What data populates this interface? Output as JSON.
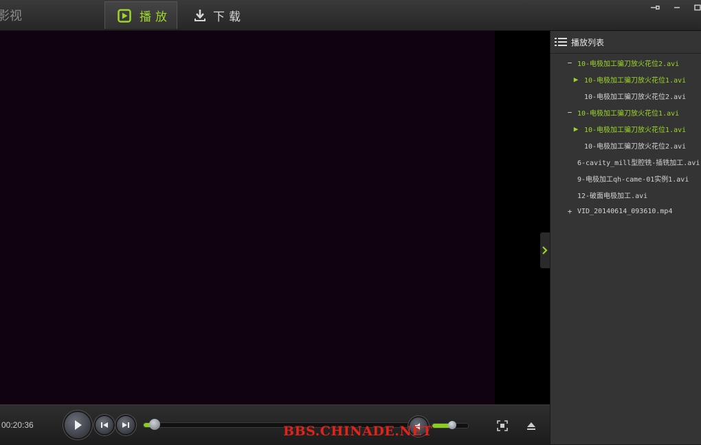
{
  "app": {
    "title": "影视"
  },
  "tabs": [
    {
      "label": "播放",
      "icon": "play-icon",
      "active": true
    },
    {
      "label": "下载",
      "icon": "download-icon",
      "active": false
    }
  ],
  "window_controls": [
    "pin-icon",
    "minimize-icon",
    "maximize-icon"
  ],
  "playlist": {
    "header": "播放列表",
    "items": [
      {
        "marker": "−",
        "label": "10-电极加工骗刀放火花位2.avi",
        "level": 0,
        "state": "folder-open"
      },
      {
        "marker": "▶",
        "label": "10-电极加工骗刀放火花位1.avi",
        "level": 1,
        "state": "playing"
      },
      {
        "marker": "",
        "label": "10-电极加工骗刀放火花位2.avi",
        "level": 1,
        "state": "normal"
      },
      {
        "marker": "−",
        "label": "10-电极加工骗刀放火花位1.avi",
        "level": 0,
        "state": "folder-open"
      },
      {
        "marker": "▶",
        "label": "10-电极加工骗刀放火花位1.avi",
        "level": 1,
        "state": "playing"
      },
      {
        "marker": "",
        "label": "10-电极加工骗刀放火花位2.avi",
        "level": 1,
        "state": "normal"
      },
      {
        "marker": "",
        "label": "6-cavity_mill型腔铣-插铣加工.avi",
        "level": 0,
        "state": "file"
      },
      {
        "marker": "",
        "label": "9-电极加工qh-came-01实例1.avi",
        "level": 0,
        "state": "file"
      },
      {
        "marker": "",
        "label": "12-破面电极加工.avi",
        "level": 0,
        "state": "file"
      },
      {
        "marker": "+",
        "label": "VID_20140614_093610.mp4",
        "level": 0,
        "state": "folder-closed"
      }
    ]
  },
  "player": {
    "time": "00:20:36",
    "progress": 0.04,
    "volume": 0.55
  },
  "watermark": "BBS.CHINADE.NET",
  "colors": {
    "accent": "#9cd62a",
    "video_bg": "#100210",
    "panel_bg": "#343434",
    "active_item": "#9cd62a",
    "normal_item": "#d4d4d4",
    "watermark": "#e0241a"
  }
}
